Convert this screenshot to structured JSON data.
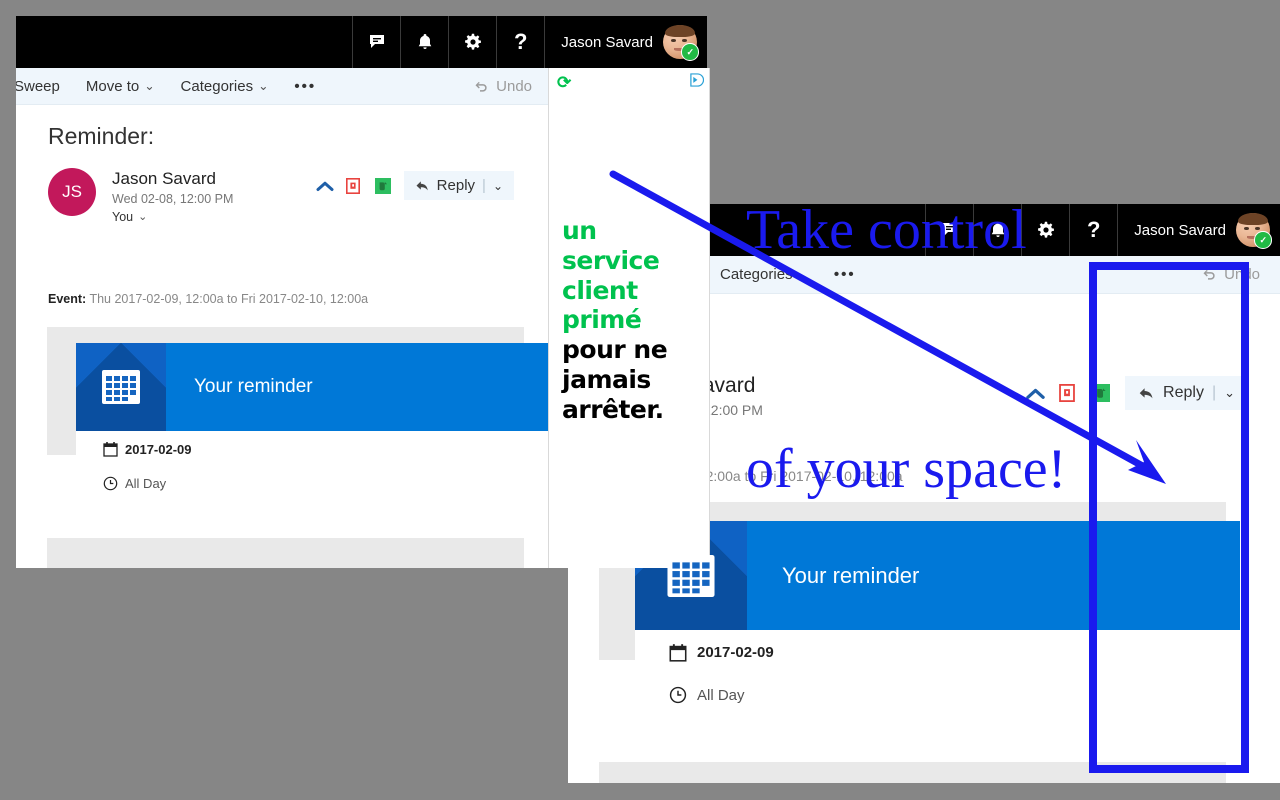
{
  "meta": {
    "background_color": "#868686",
    "accent_blue": "#0078d7",
    "annotation_blue": "#1a1aee",
    "ad_green": "#00c24e"
  },
  "annotation": {
    "headline_line1": "Take control",
    "headline_line2": "of your space!",
    "arrow_name": "pointer-arrow",
    "highlight_name": "highlight-rectangle"
  },
  "topbar": {
    "icons": [
      {
        "name": "chat-icon",
        "glyph": "speech-bubble"
      },
      {
        "name": "bell-icon",
        "glyph": "bell"
      },
      {
        "name": "gear-icon",
        "glyph": "gear"
      },
      {
        "name": "help-icon",
        "glyph": "?"
      }
    ],
    "help_label": "?",
    "user_name": "Jason Savard",
    "avatar_badge": "✓"
  },
  "commandbar": {
    "sweep": "Sweep",
    "move_to": "Move to",
    "categories": "Categories",
    "overflow": "•••",
    "undo": "Undo",
    "chevron": "⌄"
  },
  "mail": {
    "subject": "Reminder:",
    "sender_initials": "JS",
    "sender_name": "Jason Savard",
    "sender_time": "Wed 02-08, 12:00 PM",
    "recipients": "You",
    "recipients_chevron": "⌄",
    "actions": [
      {
        "name": "collapse-icon",
        "label": ""
      },
      {
        "name": "flag-icon",
        "label": ""
      },
      {
        "name": "evernote-icon",
        "label": ""
      }
    ],
    "reply_label": "Reply",
    "reply_separator": "|",
    "reply_chevron": "⌄",
    "event_label": "Event:",
    "event_value": "Thu 2017-02-09, 12:00a to Fri 2017-02-10, 12:00a"
  },
  "reminder_card": {
    "banner_title": "Your reminder",
    "calendar_icon": "calendar-icon",
    "date_value": "2017-02-09",
    "time_icon": "clock-icon",
    "time_value": "All Day"
  },
  "ad": {
    "refresh_glyph": "⟳",
    "adchoices_name": "adchoices-icon",
    "line1": "un",
    "line2": "service",
    "line3": "client",
    "line4": "primé",
    "line5": "pour ne",
    "line6": "jamais",
    "line7": "arrêter."
  }
}
